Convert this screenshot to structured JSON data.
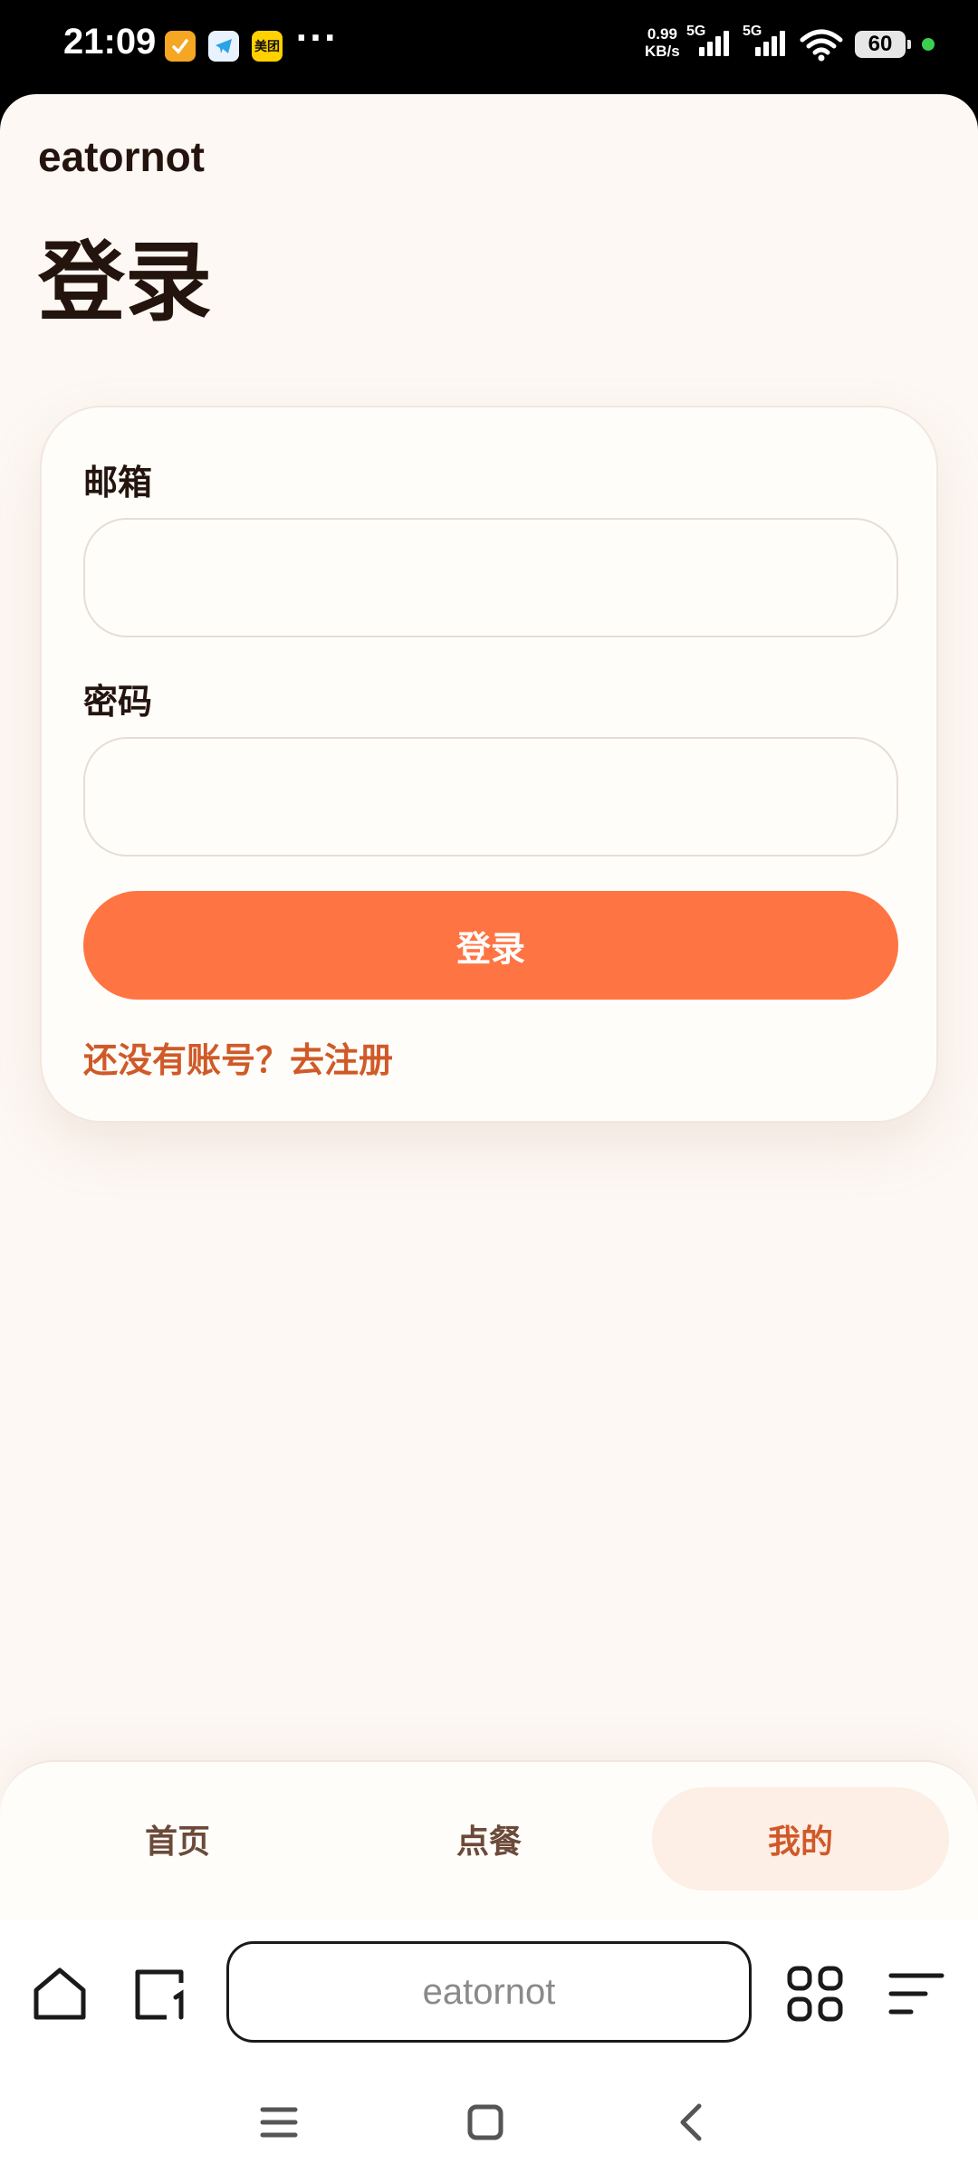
{
  "status_bar": {
    "time": "21:09",
    "notification_icons": [
      {
        "name": "app-notification-icon",
        "text": ""
      },
      {
        "name": "telegram-icon",
        "text": ""
      },
      {
        "name": "meituan-icon",
        "text": "美团"
      }
    ],
    "more": "···",
    "net_speed_value": "0.99",
    "net_speed_unit": "KB/s",
    "signal_1_label": "5G",
    "signal_2_label": "5G",
    "battery": "60"
  },
  "app": {
    "brand": "eatornot",
    "title": "登录",
    "form": {
      "email_label": "邮箱",
      "email_value": "",
      "password_label": "密码",
      "password_value": "",
      "submit_label": "登录",
      "register_link": "还没有账号？去注册"
    },
    "bottom_nav": [
      {
        "label": "首页",
        "active": false
      },
      {
        "label": "点餐",
        "active": false
      },
      {
        "label": "我的",
        "active": true
      }
    ],
    "accent_color": "#ff7443",
    "accent_text_color": "#cf5a28"
  },
  "browser": {
    "url_text": "eatornot",
    "icons": [
      "home-icon",
      "tabs-icon",
      "apps-grid-icon",
      "menu-icon"
    ]
  },
  "system_nav": {
    "icons": [
      "recents-icon",
      "home-square-icon",
      "back-icon"
    ]
  }
}
